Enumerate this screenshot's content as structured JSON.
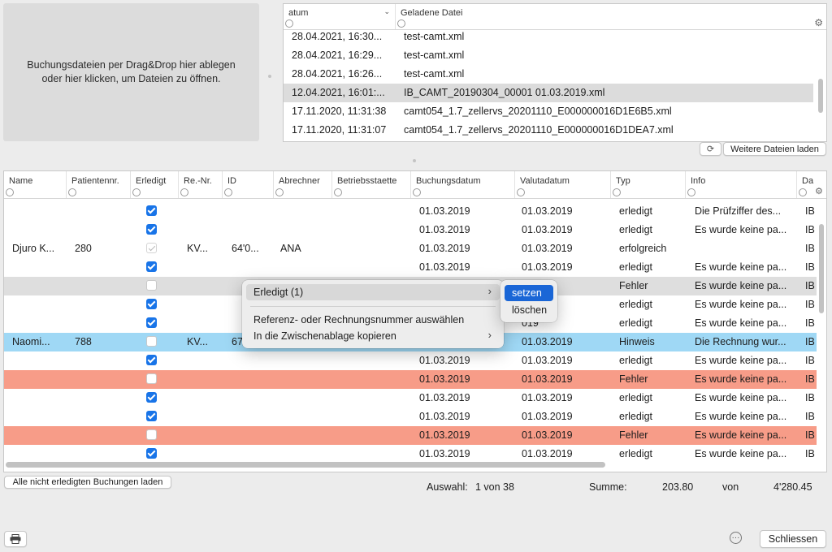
{
  "dropzone": {
    "line1": "Buchungsdateien per Drag&Drop hier ablegen",
    "line2": "oder hier klicken, um Dateien zu öffnen."
  },
  "files": {
    "headers": {
      "date": "atum",
      "file": "Geladene Datei"
    },
    "rows": [
      {
        "date": "28.04.2021, 16:30...",
        "file": "test-camt.xml"
      },
      {
        "date": "28.04.2021, 16:29...",
        "file": "test-camt.xml"
      },
      {
        "date": "28.04.2021, 16:26...",
        "file": "test-camt.xml"
      },
      {
        "date": "12.04.2021, 16:01:...",
        "file": "IB_CAMT_20190304_00001 01.03.2019.xml"
      },
      {
        "date": "17.11.2020, 11:31:38",
        "file": "camt054_1.7_zellervs_20201110_E000000016D1E6B5.xml"
      },
      {
        "date": "17.11.2020, 11:31:07",
        "file": "camt054_1.7_zellervs_20201110_E000000016D1DEA7.xml"
      }
    ],
    "more_button": "Weitere Dateien laden"
  },
  "table": {
    "headers": {
      "name": "Name",
      "patient": "Patientennr.",
      "done": "Erledigt",
      "reno": "Re.-Nr.",
      "id": "ID",
      "abrechner": "Abrechner",
      "betrieb": "Betriebsstaette",
      "buchung": "Buchungsdatum",
      "valuta": "Valutadatum",
      "typ": "Typ",
      "info": "Info",
      "da": "Da"
    },
    "rows": [
      {
        "name": "",
        "patient": "",
        "reno": "",
        "id": "",
        "abrechner": "",
        "buchung": "01.03.2019",
        "valuta": "01.03.2019",
        "typ": "erledigt",
        "info": "Die Prüfziffer des...",
        "da": "IB"
      },
      {
        "name": "",
        "patient": "",
        "reno": "",
        "id": "",
        "abrechner": "",
        "buchung": "01.03.2019",
        "valuta": "01.03.2019",
        "typ": "erledigt",
        "info": "Es wurde keine pa...",
        "da": "IB"
      },
      {
        "name": "Djuro K...",
        "patient": "280",
        "reno": "KV...",
        "id": "64'0...",
        "abrechner": "ANA",
        "buchung": "01.03.2019",
        "valuta": "01.03.2019",
        "typ": "erfolgreich",
        "info": "",
        "da": "IB"
      },
      {
        "name": "",
        "patient": "",
        "reno": "",
        "id": "",
        "abrechner": "",
        "buchung": "01.03.2019",
        "valuta": "01.03.2019",
        "typ": "erledigt",
        "info": "Es wurde keine pa...",
        "da": "IB"
      },
      {
        "name": "",
        "patient": "",
        "reno": "",
        "id": "",
        "abrechner": "",
        "buchung": "",
        "valuta": "019",
        "typ": "Fehler",
        "info": "Es wurde keine pa...",
        "da": "IB"
      },
      {
        "name": "",
        "patient": "",
        "reno": "",
        "id": "",
        "abrechner": "",
        "buchung": "",
        "valuta": "019",
        "typ": "erledigt",
        "info": "Es wurde keine pa...",
        "da": "IB"
      },
      {
        "name": "",
        "patient": "",
        "reno": "",
        "id": "",
        "abrechner": "",
        "buchung": "",
        "valuta": "019",
        "typ": "erledigt",
        "info": "Es wurde keine pa...",
        "da": "IB"
      },
      {
        "name": "Naomi...",
        "patient": "788",
        "reno": "KV...",
        "id": "67",
        "abrechner": "",
        "buchung": "",
        "valuta": "01.03.2019",
        "typ": "Hinweis",
        "info": "Die Rechnung wur...",
        "da": "IB"
      },
      {
        "name": "",
        "patient": "",
        "reno": "",
        "id": "",
        "abrechner": "",
        "buchung": "01.03.2019",
        "valuta": "01.03.2019",
        "typ": "erledigt",
        "info": "Es wurde keine pa...",
        "da": "IB"
      },
      {
        "name": "",
        "patient": "",
        "reno": "",
        "id": "",
        "abrechner": "",
        "buchung": "01.03.2019",
        "valuta": "01.03.2019",
        "typ": "Fehler",
        "info": "Es wurde keine pa...",
        "da": "IB"
      },
      {
        "name": "",
        "patient": "",
        "reno": "",
        "id": "",
        "abrechner": "",
        "buchung": "01.03.2019",
        "valuta": "01.03.2019",
        "typ": "erledigt",
        "info": "Es wurde keine pa...",
        "da": "IB"
      },
      {
        "name": "",
        "patient": "",
        "reno": "",
        "id": "",
        "abrechner": "",
        "buchung": "01.03.2019",
        "valuta": "01.03.2019",
        "typ": "erledigt",
        "info": "Es wurde keine pa...",
        "da": "IB"
      },
      {
        "name": "",
        "patient": "",
        "reno": "",
        "id": "",
        "abrechner": "",
        "buchung": "01.03.2019",
        "valuta": "01.03.2019",
        "typ": "Fehler",
        "info": "Es wurde keine pa...",
        "da": "IB"
      },
      {
        "name": "",
        "patient": "",
        "reno": "",
        "id": "",
        "abrechner": "",
        "buchung": "01.03.2019",
        "valuta": "01.03.2019",
        "typ": "erledigt",
        "info": "Es wurde keine pa...",
        "da": "IB"
      }
    ]
  },
  "context_menu": {
    "item1": "Erledigt (1)",
    "item2": "Referenz- oder Rechnungsnummer auswählen",
    "item3": "In die Zwischenablage kopieren",
    "submenu": {
      "set": "setzen",
      "delete": "löschen"
    }
  },
  "footer": {
    "load_button": "Alle nicht erledigten Buchungen laden",
    "selection_label": "Auswahl:",
    "selection_value": "1 von 38",
    "sum_label": "Summe:",
    "sum_value": "203.80",
    "of_label": "von",
    "total_value": "4'280.45",
    "close_button": "Schliessen"
  },
  "colors": {
    "accent": "#1a66d6",
    "error_row": "#f79c88",
    "hint_row": "#9fd8f5",
    "selected_row": "#dedede"
  }
}
